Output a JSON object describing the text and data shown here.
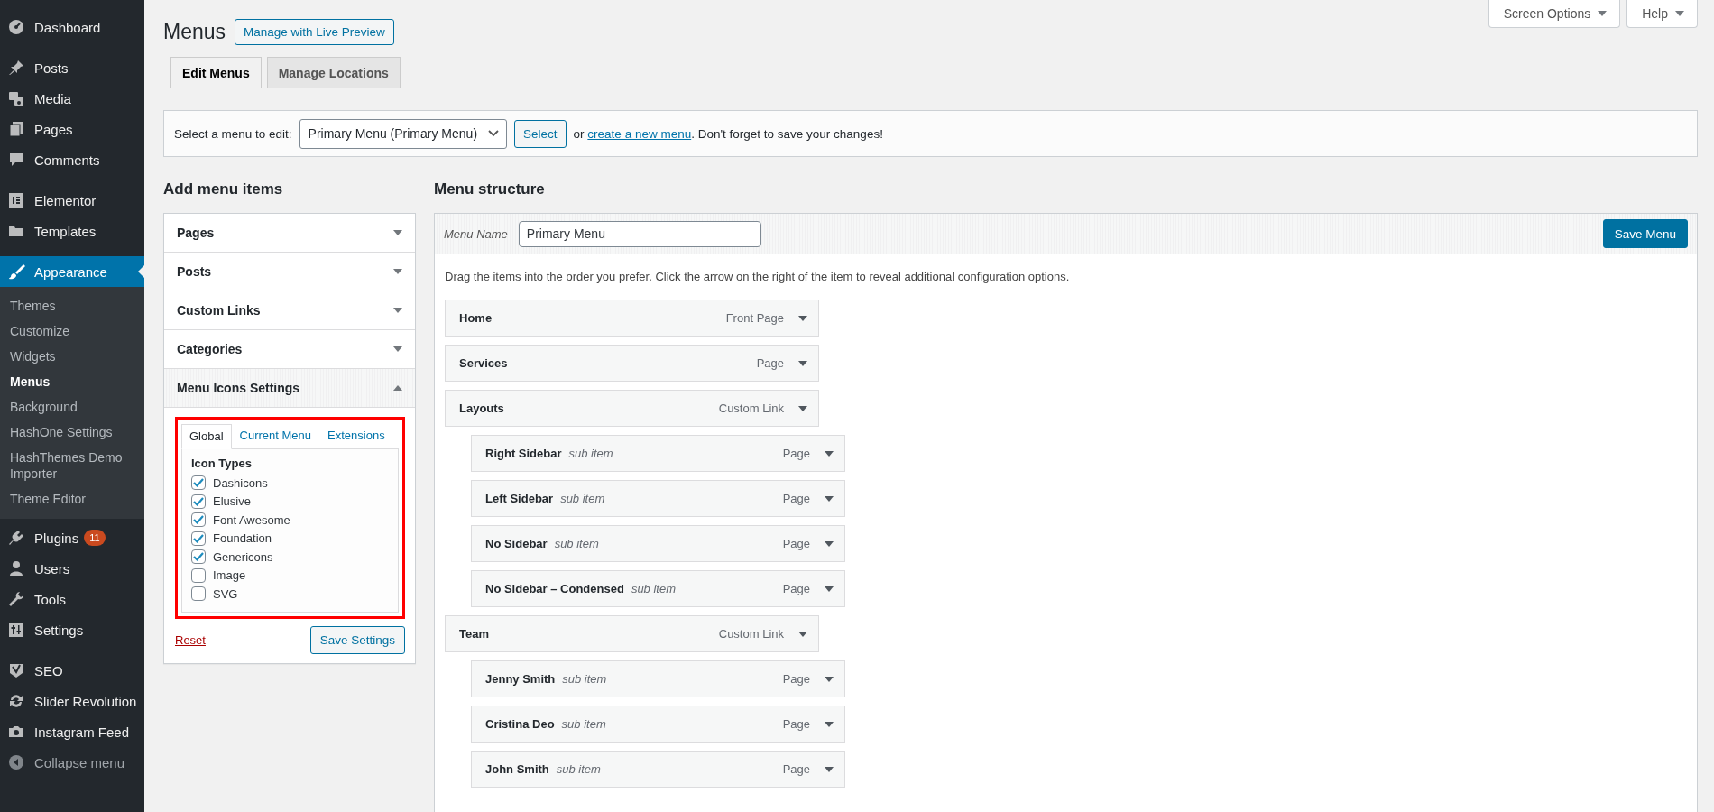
{
  "sidebar": {
    "groups": [
      [
        {
          "label": "Dashboard",
          "selected": false
        }
      ],
      [
        {
          "label": "Posts",
          "selected": false
        },
        {
          "label": "Media",
          "selected": false
        },
        {
          "label": "Pages",
          "selected": false
        },
        {
          "label": "Comments",
          "selected": false
        }
      ],
      [
        {
          "label": "Elementor",
          "selected": false
        },
        {
          "label": "Templates",
          "selected": false
        }
      ],
      [
        {
          "label": "Appearance",
          "selected": true,
          "submenu": [
            {
              "label": "Themes",
              "selected": false
            },
            {
              "label": "Customize",
              "selected": false
            },
            {
              "label": "Widgets",
              "selected": false
            },
            {
              "label": "Menus",
              "selected": true
            },
            {
              "label": "Background",
              "selected": false
            },
            {
              "label": "HashOne Settings",
              "selected": false
            },
            {
              "label": "HashThemes Demo Importer",
              "selected": false
            },
            {
              "label": "Theme Editor",
              "selected": false
            }
          ]
        },
        {
          "label": "Plugins",
          "selected": false,
          "badge": "11"
        },
        {
          "label": "Users",
          "selected": false
        },
        {
          "label": "Tools",
          "selected": false
        },
        {
          "label": "Settings",
          "selected": false
        }
      ],
      [
        {
          "label": "SEO",
          "selected": false
        },
        {
          "label": "Slider Revolution",
          "selected": false
        },
        {
          "label": "Instagram Feed",
          "selected": false
        },
        {
          "label": "Collapse menu",
          "selected": false
        }
      ]
    ]
  },
  "screen_meta": [
    "Screen Options",
    "Help"
  ],
  "header": {
    "title": "Menus",
    "button": "Manage with Live Preview"
  },
  "tabs": [
    {
      "label": "Edit Menus",
      "selected": true
    },
    {
      "label": "Manage Locations",
      "selected": false
    }
  ],
  "menu_select": {
    "label": "Select a menu to edit:",
    "value": "Primary Menu (Primary Menu)",
    "button": "Select",
    "text_before": "or",
    "link": "create a new menu",
    "text_after": ". Don't forget to save your changes!"
  },
  "add_items": {
    "title": "Add menu items",
    "sections": [
      {
        "label": "Pages",
        "expanded": false
      },
      {
        "label": "Posts",
        "expanded": false
      },
      {
        "label": "Custom Links",
        "expanded": false
      },
      {
        "label": "Categories",
        "expanded": false
      },
      {
        "label": "Menu Icons Settings",
        "expanded": true
      }
    ],
    "icon_settings": {
      "tabs": [
        {
          "label": "Global",
          "selected": true
        },
        {
          "label": "Current Menu",
          "selected": false
        },
        {
          "label": "Extensions",
          "selected": false
        }
      ],
      "group_title": "Icon Types",
      "types": [
        {
          "label": "Dashicons",
          "checked": true
        },
        {
          "label": "Elusive",
          "checked": true
        },
        {
          "label": "Font Awesome",
          "checked": true
        },
        {
          "label": "Foundation",
          "checked": true
        },
        {
          "label": "Genericons",
          "checked": true
        },
        {
          "label": "Image",
          "checked": false
        },
        {
          "label": "SVG",
          "checked": false
        }
      ],
      "reset": "Reset",
      "save": "Save Settings"
    }
  },
  "menu_structure": {
    "title": "Menu structure",
    "name_label": "Menu Name",
    "name_value": "Primary Menu",
    "save": "Save Menu",
    "instructions": "Drag the items into the order you prefer. Click the arrow on the right of the item to reveal additional configuration options.",
    "items": [
      {
        "title": "Home",
        "type": "Front Page"
      },
      {
        "title": "Services",
        "type": "Page"
      },
      {
        "title": "Layouts",
        "type": "Custom Link",
        "children": [
          {
            "title": "Right Sidebar",
            "note": "sub item",
            "type": "Page"
          },
          {
            "title": "Left Sidebar",
            "note": "sub item",
            "type": "Page"
          },
          {
            "title": "No Sidebar",
            "note": "sub item",
            "type": "Page"
          },
          {
            "title": "No Sidebar – Condensed",
            "note": "sub item",
            "type": "Page"
          }
        ]
      },
      {
        "title": "Team",
        "type": "Custom Link",
        "children": [
          {
            "title": "Jenny Smith",
            "note": "sub item",
            "type": "Page"
          },
          {
            "title": "Cristina Deo",
            "note": "sub item",
            "type": "Page"
          },
          {
            "title": "John Smith",
            "note": "sub item",
            "type": "Page"
          }
        ]
      }
    ]
  }
}
